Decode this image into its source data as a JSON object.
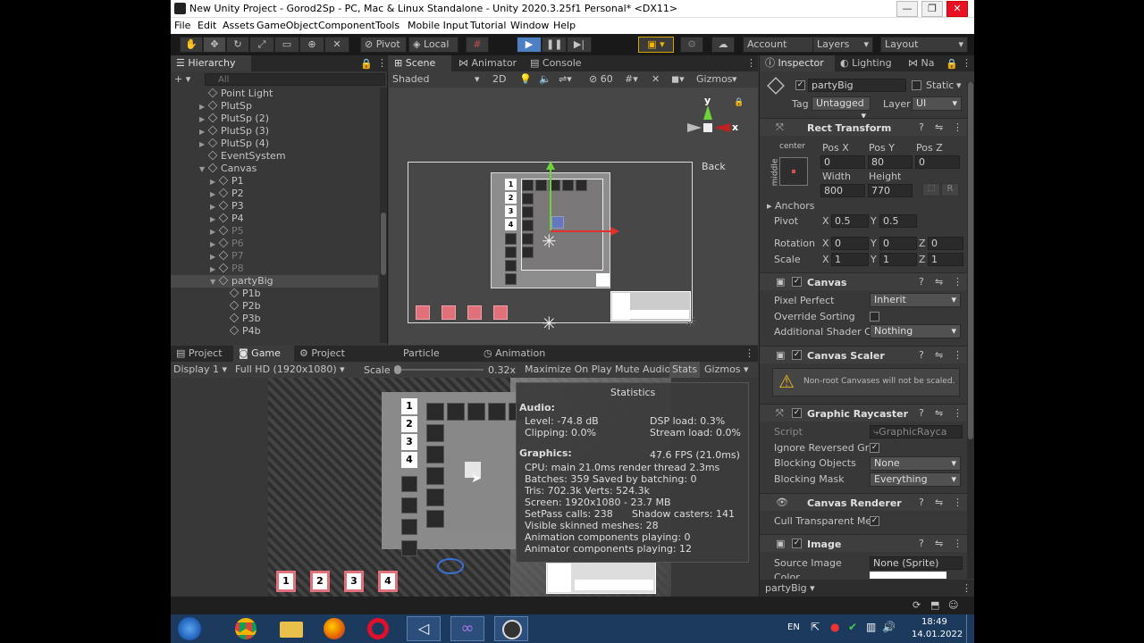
{
  "window": {
    "title": "New Unity Project - Gorod2Sp - PC, Mac & Linux Standalone - Unity 2020.3.25f1 Personal* <DX11>",
    "minimize": "—",
    "maximize": "❐",
    "close": "✕"
  },
  "menu": [
    "File",
    "Edit",
    "Assets",
    "GameObject",
    "Component",
    "Tools",
    "Mobile Input",
    "Tutorial",
    "Window",
    "Help"
  ],
  "toolbar": {
    "pivot": "Pivot",
    "local": "Local",
    "account": "Account",
    "layers": "Layers",
    "layout": "Layout"
  },
  "hierarchy": {
    "tab": "Hierarchy",
    "search_placeholder": "All",
    "add": "+ ▾",
    "items": [
      {
        "label": "Point Light",
        "depth": 1,
        "arrow": "",
        "dim": false,
        "sel": false
      },
      {
        "label": "PlutSp",
        "depth": 1,
        "arrow": "▶",
        "dim": false,
        "sel": false
      },
      {
        "label": "PlutSp (2)",
        "depth": 1,
        "arrow": "▶",
        "dim": false,
        "sel": false
      },
      {
        "label": "PlutSp (3)",
        "depth": 1,
        "arrow": "▶",
        "dim": false,
        "sel": false
      },
      {
        "label": "PlutSp (4)",
        "depth": 1,
        "arrow": "▶",
        "dim": false,
        "sel": false
      },
      {
        "label": "EventSystem",
        "depth": 1,
        "arrow": "",
        "dim": false,
        "sel": false
      },
      {
        "label": "Canvas",
        "depth": 1,
        "arrow": "▼",
        "dim": false,
        "sel": false
      },
      {
        "label": "P1",
        "depth": 2,
        "arrow": "▶",
        "dim": false,
        "sel": false
      },
      {
        "label": "P2",
        "depth": 2,
        "arrow": "▶",
        "dim": false,
        "sel": false
      },
      {
        "label": "P3",
        "depth": 2,
        "arrow": "▶",
        "dim": false,
        "sel": false
      },
      {
        "label": "P4",
        "depth": 2,
        "arrow": "▶",
        "dim": false,
        "sel": false
      },
      {
        "label": "P5",
        "depth": 2,
        "arrow": "▶",
        "dim": true,
        "sel": false
      },
      {
        "label": "P6",
        "depth": 2,
        "arrow": "▶",
        "dim": true,
        "sel": false
      },
      {
        "label": "P7",
        "depth": 2,
        "arrow": "▶",
        "dim": true,
        "sel": false
      },
      {
        "label": "P8",
        "depth": 2,
        "arrow": "▶",
        "dim": true,
        "sel": false
      },
      {
        "label": "partyBig",
        "depth": 2,
        "arrow": "▼",
        "dim": false,
        "sel": true
      },
      {
        "label": "P1b",
        "depth": 3,
        "arrow": "",
        "dim": false,
        "sel": false
      },
      {
        "label": "P2b",
        "depth": 3,
        "arrow": "",
        "dim": false,
        "sel": false
      },
      {
        "label": "P3b",
        "depth": 3,
        "arrow": "",
        "dim": false,
        "sel": false
      },
      {
        "label": "P4b",
        "depth": 3,
        "arrow": "",
        "dim": false,
        "sel": false
      }
    ]
  },
  "scene": {
    "tabs": [
      "Scene",
      "Animator",
      "Console"
    ],
    "shading": "Shaded",
    "mode_2d": "2D",
    "gizmos": "Gizmos",
    "fov": "60",
    "back": "Back",
    "axis_y": "y",
    "axis_x": "x",
    "digits": [
      "1",
      "2",
      "3",
      "4"
    ]
  },
  "bottom": {
    "tabs": [
      "Project",
      "Game",
      "Project Settings",
      "Particle Effect",
      "Animation"
    ],
    "display": "Display 1",
    "resolution": "Full HD (1920x1080)",
    "scale_label": "Scale",
    "scale_value": "0.32x",
    "maximize": "Maximize On Play",
    "mute": "Mute Audio",
    "stats": "Stats",
    "gizmos": "Gizmos"
  },
  "game": {
    "digits": [
      "1",
      "2",
      "3",
      "4"
    ]
  },
  "stats": {
    "title": "Statistics",
    "audio_header": "Audio:",
    "level": "Level: -74.8 dB",
    "dsp": "DSP load: 0.3%",
    "clipping": "Clipping: 0.0%",
    "stream": "Stream load: 0.0%",
    "fps": "47.6 FPS (21.0ms)",
    "graphics_header": "Graphics:",
    "cpu": "CPU: main 21.0ms  render thread 2.3ms",
    "batches": "Batches: 359   Saved by batching: 0",
    "tris": "Tris: 702.3k     Verts: 524.3k",
    "screen": "Screen: 1920x1080 - 23.7 MB",
    "setpass": "SetPass calls: 238",
    "shadow": "Shadow casters: 141",
    "skinned": "Visible skinned meshes: 28",
    "anim": "Animation components playing: 0",
    "animator": "Animator components playing: 12"
  },
  "inspector": {
    "tabs": [
      "Inspector",
      "Lighting",
      "Na"
    ],
    "object_name": "partyBig",
    "static": "Static",
    "tag_label": "Tag",
    "tag": "Untagged",
    "layer_label": "Layer",
    "layer": "UI",
    "rect": {
      "title": "Rect Transform",
      "anchor_top": "center",
      "anchor_side": "middle",
      "posx_l": "Pos X",
      "posy_l": "Pos Y",
      "posz_l": "Pos Z",
      "posx": "0",
      "posy": "80",
      "posz": "0",
      "width_l": "Width",
      "height_l": "Height",
      "width": "800",
      "height": "770",
      "r": "R",
      "anchors": "Anchors",
      "pivot": "Pivot",
      "pivot_x": "0.5",
      "pivot_y": "0.5",
      "rotation": "Rotation",
      "rot_x": "0",
      "rot_y": "0",
      "rot_z": "0",
      "scale": "Scale",
      "sc_x": "1",
      "sc_y": "1",
      "sc_z": "1",
      "X": "X",
      "Y": "Y",
      "Z": "Z"
    },
    "canvas": {
      "title": "Canvas",
      "pixel_perfect": "Pixel Perfect",
      "pixel_val": "Inherit",
      "override": "Override Sorting",
      "shader": "Additional Shader Ch",
      "shader_val": "Nothing"
    },
    "scaler": {
      "title": "Canvas Scaler",
      "warning": "Non-root Canvases will not be scaled."
    },
    "raycaster": {
      "title": "Graphic Raycaster",
      "script": "Script",
      "script_val": "GraphicRayca",
      "ignore": "Ignore Reversed Gra",
      "blocking": "Blocking Objects",
      "blocking_val": "None",
      "mask": "Blocking Mask",
      "mask_val": "Everything"
    },
    "renderer": {
      "title": "Canvas Renderer",
      "cull": "Cull Transparent Me"
    },
    "image": {
      "title": "Image",
      "source": "Source Image",
      "source_val": "None (Sprite)",
      "color": "Color"
    },
    "footer": "partyBig ▾"
  },
  "taskbar": {
    "lang": "EN",
    "time": "18:49",
    "date": "14.01.2022"
  },
  "colors": {
    "accent": "#3a78c9",
    "pink": "#e0707a",
    "warning": "#e8b21f"
  }
}
